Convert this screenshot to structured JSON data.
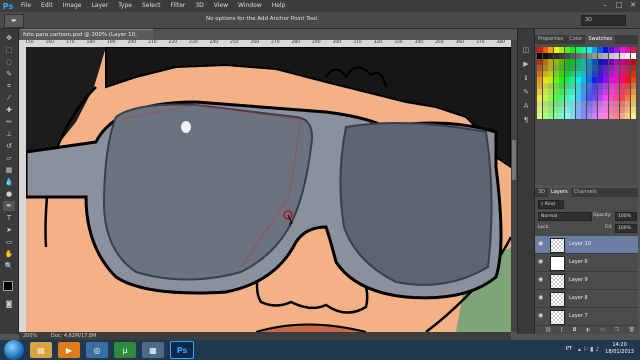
{
  "app": {
    "logo": "Ps"
  },
  "menu": [
    "File",
    "Edit",
    "Image",
    "Layer",
    "Type",
    "Select",
    "Filter",
    "3D",
    "View",
    "Window",
    "Help"
  ],
  "window_controls": [
    "–",
    "□",
    "✕"
  ],
  "options": {
    "message": "No options for the Add Anchor Point Tool.",
    "workspace": "3D"
  },
  "document": {
    "tab_title": "foto para cartoon.psd @ 200% (Layer 10, RGB/8) *",
    "tab_close": "×",
    "ruler_ticks": [
      "150",
      "160",
      "170",
      "180",
      "190",
      "200",
      "210",
      "220",
      "230",
      "240",
      "250",
      "260",
      "270",
      "280",
      "290",
      "300",
      "310",
      "320",
      "330",
      "340",
      "350",
      "360",
      "370",
      "380"
    ],
    "zoom": "200%",
    "doc_info": "Doc: 4,62M/17,8M"
  },
  "panels": {
    "top_tabs": [
      "Properties",
      "Color",
      "Swatches"
    ],
    "active_top_tab": "Swatches",
    "layer_tabs": [
      "3D",
      "Layers",
      "Channels"
    ],
    "active_layer_tab": "Layers",
    "filter_kind": "Kind",
    "blend_mode": "Normal",
    "opacity_label": "Opacity:",
    "opacity_value": "100%",
    "lock_label": "Lock:",
    "fill_label": "Fill:",
    "fill_value": "100%",
    "layers": [
      {
        "name": "Layer 10",
        "selected": true
      },
      {
        "name": "Layer 6",
        "selected": false
      },
      {
        "name": "Layer 9",
        "selected": false
      },
      {
        "name": "Layer 8",
        "selected": false
      },
      {
        "name": "Layer 7",
        "selected": false
      }
    ],
    "layer_footer_icons": [
      "link-icon",
      "fx-icon",
      "mask-icon",
      "adjustment-icon",
      "folder-icon",
      "new-layer-icon",
      "trash-icon"
    ]
  },
  "taskbar": {
    "apps": [
      "explorer-icon",
      "media-player-icon",
      "chrome-icon",
      "utorrent-icon",
      "network-icon",
      "photoshop-icon"
    ],
    "language": "PT",
    "time": "14:20",
    "date": "18/01/2013"
  },
  "colors": {
    "skin": "#f4b186",
    "hair": "#1a1a1a",
    "lens": "#6b7280",
    "frame": "#8a909c",
    "ps_blue": "#31a8ff"
  }
}
